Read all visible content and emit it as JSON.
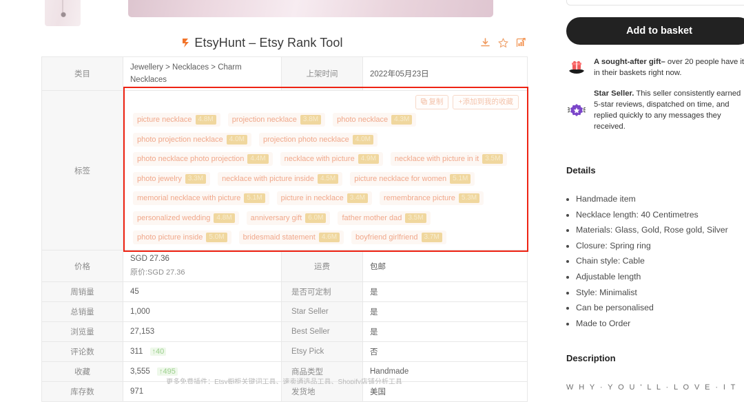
{
  "etsyhunt": {
    "title": "EtsyHunt – Etsy Rank Tool",
    "icons": [
      "download-icon",
      "star-icon",
      "chart-icon"
    ],
    "logo": "etsyhunt-logo-icon"
  },
  "table": {
    "category_label": "类目",
    "category_value": "Jewellery > Necklaces > Charm Necklaces",
    "listed_label": "上架时间",
    "listed_value": "2022年05月23日",
    "tags_label": "标签",
    "copy_label": "复制",
    "favorite_label": "+添加到我的收藏",
    "rows": [
      {
        "label": "价格",
        "value": "SGD 27.36",
        "sub": "原价:SGD 27.36",
        "value_color": "dark",
        "label2": "运费",
        "value2": "包邮"
      },
      {
        "label": "周销量",
        "value": "45",
        "value_color": "orange",
        "label2": "是否可定制",
        "value2": "是"
      },
      {
        "label": "总销量",
        "value": "1,000",
        "value_color": "orange",
        "label2": "Star Seller",
        "value2": "是"
      },
      {
        "label": "浏览量",
        "value": "27,153",
        "value_color": "orange",
        "label2": "Best Seller",
        "value2": "是"
      },
      {
        "label": "评论数",
        "value": "311",
        "delta": "↑40",
        "value_color": "dark",
        "label2": "Etsy Pick",
        "value2": "否",
        "value2_color": "orange"
      },
      {
        "label": "收藏",
        "value": "3,555",
        "delta": "↑495",
        "value_color": "dark",
        "label2": "商品类型",
        "value2": "Handmade"
      },
      {
        "label": "库存数",
        "value": "971",
        "value_color": "dark",
        "label2": "发货地",
        "value2": "美国"
      }
    ]
  },
  "tags": [
    [
      {
        "t": "picture necklace",
        "c": "4.8M"
      },
      {
        "t": "projection necklace",
        "c": "3.8M"
      },
      {
        "t": "photo necklace",
        "c": "4.3M"
      }
    ],
    [
      {
        "t": "photo projection necklace",
        "c": "4.0M"
      },
      {
        "t": "projection photo necklace",
        "c": "4.0M"
      }
    ],
    [
      {
        "t": "photo necklace photo projection",
        "c": "4.4M"
      },
      {
        "t": "necklace with picture",
        "c": "4.9M"
      },
      {
        "t": "necklace with picture in it",
        "c": "3.5M"
      }
    ],
    [
      {
        "t": "photo jewelry",
        "c": "3.3M"
      },
      {
        "t": "necklace with picture inside",
        "c": "4.5M"
      },
      {
        "t": "picture necklace for women",
        "c": "5.1M"
      }
    ],
    [
      {
        "t": "memorial necklace with picture",
        "c": "5.1M"
      },
      {
        "t": "picture in necklace",
        "c": "3.4M"
      },
      {
        "t": "remembrance picture",
        "c": "5.3M"
      }
    ],
    [
      {
        "t": "personalized wedding",
        "c": "4.8M"
      },
      {
        "t": "anniversary gift",
        "c": "6.0M"
      },
      {
        "t": "father mother dad",
        "c": "3.5M"
      }
    ],
    [
      {
        "t": "photo picture inside",
        "c": "5.0M"
      },
      {
        "t": "bridesmaid statement",
        "c": "4.6M"
      },
      {
        "t": "boyfriend girlfriend",
        "c": "3.7M"
      }
    ]
  ],
  "footer": "更多免费插件：Etsy橱柜关键词工具、速卖通选品工具、Shopify店铺分析工具",
  "listing": {
    "add_to_basket": "Add to basket",
    "gift_text_bold": "A sought-after gift–",
    "gift_text_rest": " over 20 people have it in their baskets right now.",
    "star_text_bold": "Star Seller.",
    "star_text_rest": " This seller consistently earned 5-star reviews, dispatched on time, and replied quickly to any messages they received.",
    "details_heading": "Details",
    "details": [
      "Handmade item",
      "Necklace length: 40 Centimetres",
      "Materials: Glass, Gold, Rose gold, Silver",
      "Closure: Spring ring",
      "Chain style: Cable",
      "Adjustable length",
      "Style: Minimalist",
      "Can be personalised",
      "Made to Order"
    ],
    "description_heading": "Description",
    "why_you_love_it": "W H Y · Y O U ' L L · L O V E · I T"
  },
  "colors": {
    "accent_orange": "#e8833a",
    "tag_text": "#f0a88b",
    "tag_badge": "#f0d79e",
    "highlight_red": "#ee2212",
    "button_dark": "#222222",
    "delta_green": "#9ccf8e"
  }
}
